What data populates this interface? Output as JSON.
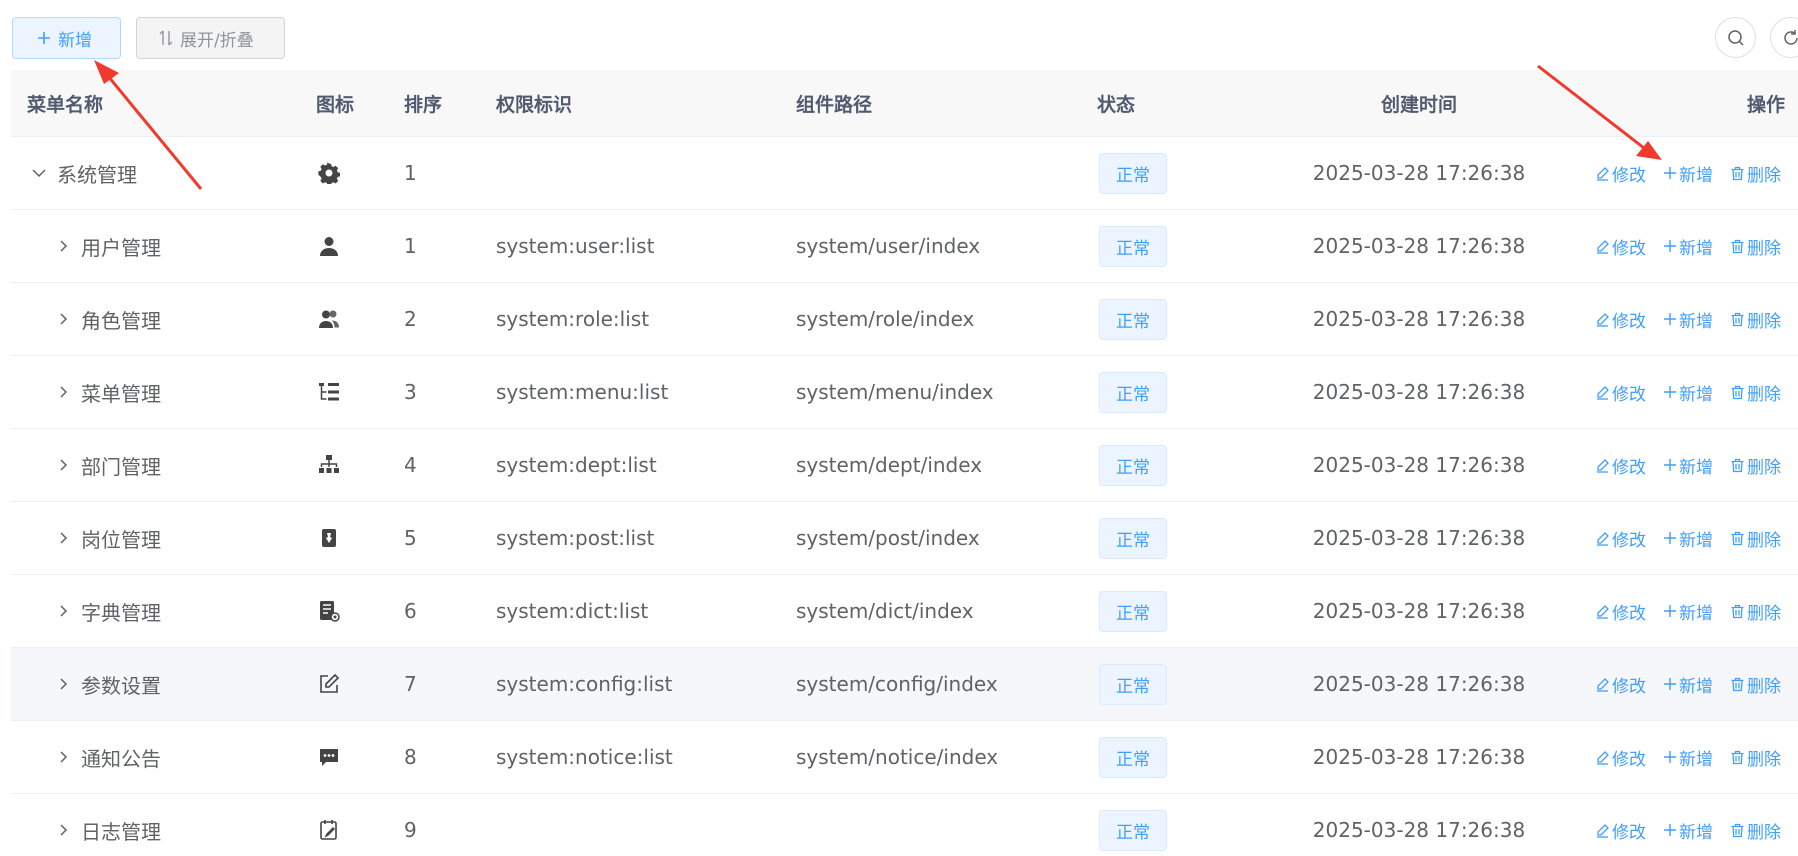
{
  "toolbar": {
    "add_label": "新增",
    "toggle_label": "展开/折叠"
  },
  "table": {
    "headers": {
      "name": "菜单名称",
      "icon": "图标",
      "sort": "排序",
      "perm": "权限标识",
      "component": "组件路径",
      "status": "状态",
      "time": "创建时间",
      "ops": "操作"
    },
    "ops": {
      "edit": "修改",
      "add": "新增",
      "delete": "删除"
    },
    "rows": [
      {
        "name": "系统管理",
        "icon": "gear-icon",
        "sort": "1",
        "perm": "",
        "component": "",
        "status": "正常",
        "time": "2025-03-28 17:26:38",
        "expanded": true
      },
      {
        "name": "用户管理",
        "icon": "user-icon",
        "sort": "1",
        "perm": "system:user:list",
        "component": "system/user/index",
        "status": "正常",
        "time": "2025-03-28 17:26:38"
      },
      {
        "name": "角色管理",
        "icon": "peoples-icon",
        "sort": "2",
        "perm": "system:role:list",
        "component": "system/role/index",
        "status": "正常",
        "time": "2025-03-28 17:26:38"
      },
      {
        "name": "菜单管理",
        "icon": "tree-table-icon",
        "sort": "3",
        "perm": "system:menu:list",
        "component": "system/menu/index",
        "status": "正常",
        "time": "2025-03-28 17:26:38"
      },
      {
        "name": "部门管理",
        "icon": "org-tree-icon",
        "sort": "4",
        "perm": "system:dept:list",
        "component": "system/dept/index",
        "status": "正常",
        "time": "2025-03-28 17:26:38"
      },
      {
        "name": "岗位管理",
        "icon": "post-icon",
        "sort": "5",
        "perm": "system:post:list",
        "component": "system/post/index",
        "status": "正常",
        "time": "2025-03-28 17:26:38"
      },
      {
        "name": "字典管理",
        "icon": "dict-icon",
        "sort": "6",
        "perm": "system:dict:list",
        "component": "system/dict/index",
        "status": "正常",
        "time": "2025-03-28 17:26:38"
      },
      {
        "name": "参数设置",
        "icon": "edit-icon",
        "sort": "7",
        "perm": "system:config:list",
        "component": "system/config/index",
        "status": "正常",
        "time": "2025-03-28 17:26:38"
      },
      {
        "name": "通知公告",
        "icon": "message-icon",
        "sort": "8",
        "perm": "system:notice:list",
        "component": "system/notice/index",
        "status": "正常",
        "time": "2025-03-28 17:26:38"
      },
      {
        "name": "日志管理",
        "icon": "log-icon",
        "sort": "9",
        "perm": "",
        "component": "",
        "status": "正常",
        "time": "2025-03-28 17:26:38"
      }
    ]
  },
  "colors": {
    "primary": "#409eff",
    "annotation": "#f03a2e"
  }
}
